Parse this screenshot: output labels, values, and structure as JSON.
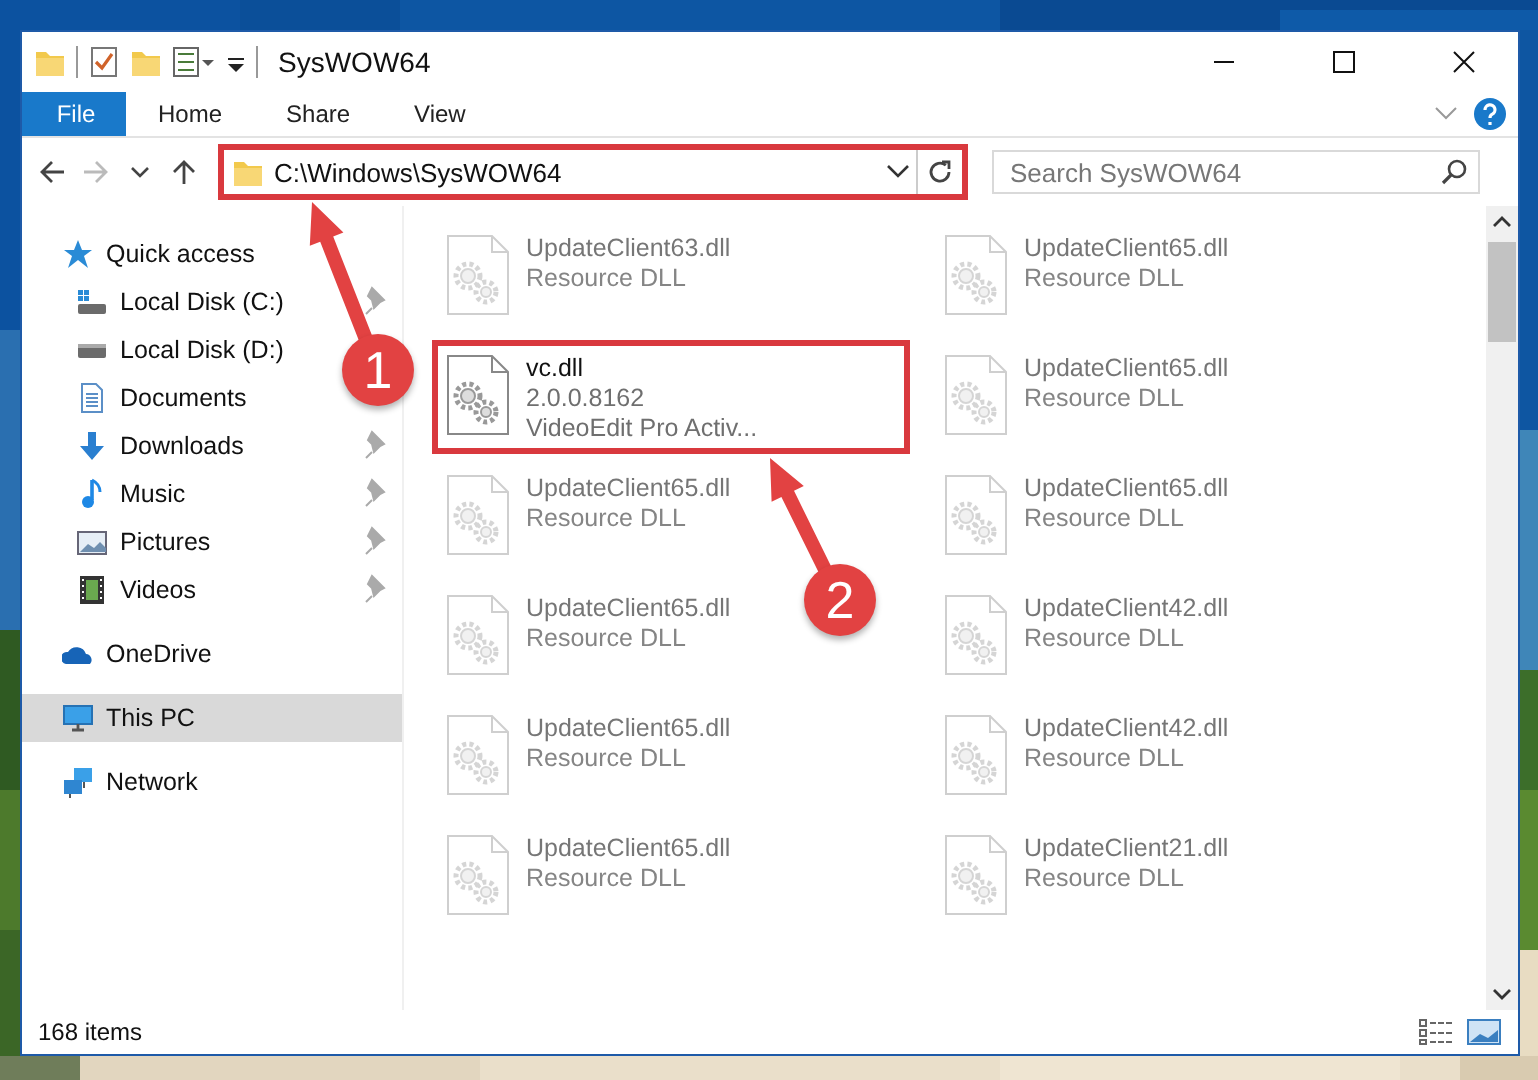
{
  "window": {
    "title": "SysWOW64"
  },
  "ribbon_tabs": [
    {
      "label": "File",
      "selected": true
    },
    {
      "label": "Home",
      "selected": false
    },
    {
      "label": "Share",
      "selected": false
    },
    {
      "label": "View",
      "selected": false
    }
  ],
  "address_bar": {
    "value": "C:\\Windows\\SysWOW64",
    "highlighted": true
  },
  "search": {
    "placeholder": "Search SysWOW64"
  },
  "sidebar": {
    "items": [
      {
        "label": "Quick access",
        "kind": "star",
        "pinned": false,
        "selected": false,
        "children": [
          {
            "label": "Local Disk (C:)",
            "kind": "drive-c",
            "pinned": true,
            "selected": false
          },
          {
            "label": "Local Disk (D:)",
            "kind": "drive",
            "pinned": false,
            "selected": false
          },
          {
            "label": "Documents",
            "kind": "documents",
            "pinned": false,
            "selected": false
          },
          {
            "label": "Downloads",
            "kind": "downloads",
            "pinned": true,
            "selected": false
          },
          {
            "label": "Music",
            "kind": "music",
            "pinned": true,
            "selected": false
          },
          {
            "label": "Pictures",
            "kind": "pictures",
            "pinned": true,
            "selected": false
          },
          {
            "label": "Videos",
            "kind": "videos",
            "pinned": true,
            "selected": false
          }
        ]
      },
      {
        "label": "OneDrive",
        "kind": "cloud",
        "pinned": false,
        "selected": false
      },
      {
        "label": "This PC",
        "kind": "pc",
        "pinned": false,
        "selected": true
      },
      {
        "label": "Network",
        "kind": "network",
        "pinned": false,
        "selected": false
      }
    ]
  },
  "files": [
    {
      "name": "UpdateClient63.dll",
      "details": [
        "Resource DLL"
      ],
      "blurred": true,
      "highlighted": false
    },
    {
      "name": "UpdateClient65.dll",
      "details": [
        "Resource DLL"
      ],
      "blurred": true,
      "highlighted": false
    },
    {
      "name": "vc.dll",
      "details": [
        "2.0.0.8162",
        "VideoEdit Pro Activ..."
      ],
      "blurred": false,
      "highlighted": true
    },
    {
      "name": "UpdateClient65.dll",
      "details": [
        "Resource DLL"
      ],
      "blurred": true,
      "highlighted": false
    },
    {
      "name": "UpdateClient65.dll",
      "details": [
        "Resource DLL"
      ],
      "blurred": true,
      "highlighted": false
    },
    {
      "name": "UpdateClient65.dll",
      "details": [
        "Resource DLL"
      ],
      "blurred": true,
      "highlighted": false
    },
    {
      "name": "UpdateClient65.dll",
      "details": [
        "Resource DLL"
      ],
      "blurred": true,
      "highlighted": false
    },
    {
      "name": "UpdateClient42.dll",
      "details": [
        "Resource DLL"
      ],
      "blurred": true,
      "highlighted": false
    },
    {
      "name": "UpdateClient65.dll",
      "details": [
        "Resource DLL"
      ],
      "blurred": true,
      "highlighted": false
    },
    {
      "name": "UpdateClient42.dll",
      "details": [
        "Resource DLL"
      ],
      "blurred": true,
      "highlighted": false
    },
    {
      "name": "UpdateClient65.dll",
      "details": [
        "Resource DLL"
      ],
      "blurred": true,
      "highlighted": false
    },
    {
      "name": "UpdateClient21.dll",
      "details": [
        "Resource DLL"
      ],
      "blurred": true,
      "highlighted": false
    }
  ],
  "status_bar": {
    "item_count": "168 items"
  },
  "annotations": [
    {
      "label": "1"
    },
    {
      "label": "2"
    }
  ]
}
